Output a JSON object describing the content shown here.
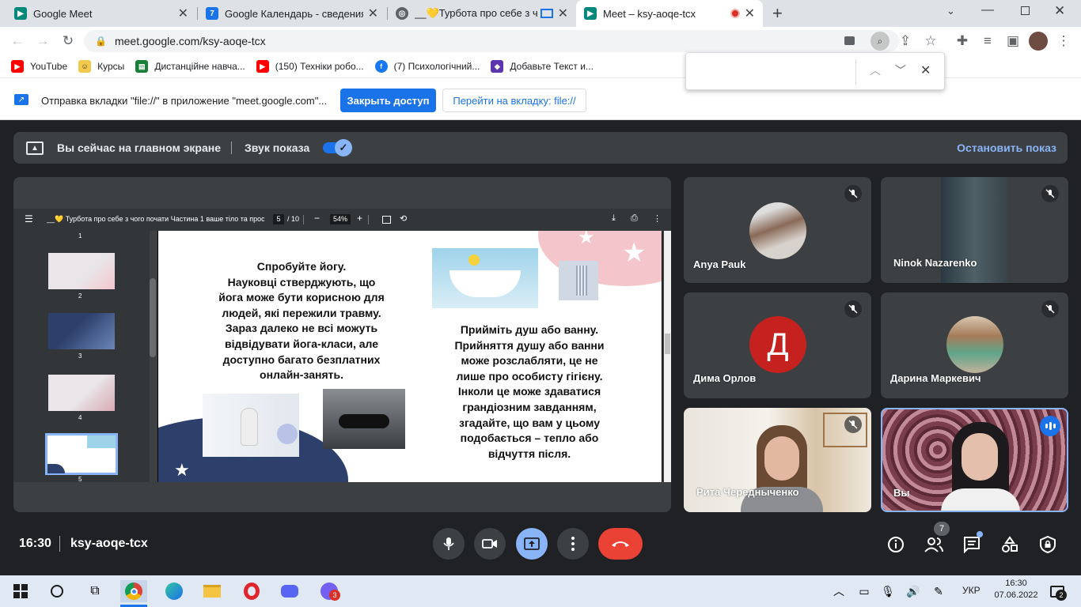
{
  "browser": {
    "tabs": [
      {
        "title": "Google Meet",
        "close": "✕"
      },
      {
        "title": "Google Календарь - сведения о",
        "close": "✕"
      },
      {
        "title": "__💛Турбота про себе з чо",
        "close": "✕"
      },
      {
        "title": "Meet – ksy-aoqe-tcx",
        "close": "✕"
      }
    ],
    "new_tab": "+",
    "url": "meet.google.com/ksy-aoqe-tcx",
    "bookmarks": [
      "YouTube",
      "Курсы",
      "Дистанційне навча...",
      "(150) Техніки робо...",
      "(7) Психологічний...",
      "Добавьте Текст и..."
    ],
    "infobar": {
      "message": "Отправка вкладки \"file://\" в приложение \"meet.google.com\"...",
      "primary_button": "Закрыть доступ",
      "secondary_button": "Перейти на вкладку: file://"
    },
    "find_bar": {
      "value": ""
    }
  },
  "meet": {
    "present_bar": {
      "status": "Вы сейчас на главном экране",
      "audio_label": "Звук показа",
      "audio_on": true,
      "stop_button": "Остановить показ"
    },
    "pdf": {
      "title": "__💛 Турбота про себе з чого почати Частина 1 ваше тіло та прості...",
      "page_current": "5",
      "page_total": "/ 10",
      "zoom": "54%",
      "thumb_numbers": [
        "1",
        "2",
        "3",
        "4",
        "5"
      ],
      "slide_left_text": [
        "Спробуйте йогу.",
        "Науковці стверджують, що",
        "йога може бути корисною для",
        "людей, які пережили травму.",
        "Зараз далеко не всі можуть",
        "відвідувати йога-класи, але",
        "доступно багато безплатних",
        "онлайн-занять."
      ],
      "slide_right_text": [
        "Прийміть душ або ванну.",
        "Прийняття душу або ванни",
        "може розслабляти, це не",
        "лише про особисту гігієну.",
        "Інколи це може здаватися",
        "грандіозним завданням,",
        "згадайте, що вам у цьому",
        "подобається – тепло або",
        "відчуття після."
      ]
    },
    "participants": [
      {
        "name": "Anya Pauk",
        "muted": true
      },
      {
        "name": "Ninok Nazarenko",
        "muted": true
      },
      {
        "name": "Дима Орлов",
        "muted": true,
        "initial": "Д",
        "color": "#c5221f"
      },
      {
        "name": "Дарина Маркевич",
        "muted": true
      },
      {
        "name": "Рита Чередныченко",
        "muted": true
      },
      {
        "name": "Вы",
        "muted": false
      }
    ],
    "footer": {
      "time": "16:30",
      "meeting_code": "ksy-aoqe-tcx",
      "people_count": "7"
    }
  },
  "taskbar": {
    "lang": "УКР",
    "time": "16:30",
    "date": "07.06.2022",
    "viber_badge": "3",
    "notif_badge": "2"
  },
  "colors": {
    "meet_bg": "#202124",
    "tile_bg": "#3c4043",
    "accent_blue": "#1a73e8",
    "end_call_red": "#ea4335",
    "present_active": "#8ab4f8"
  }
}
